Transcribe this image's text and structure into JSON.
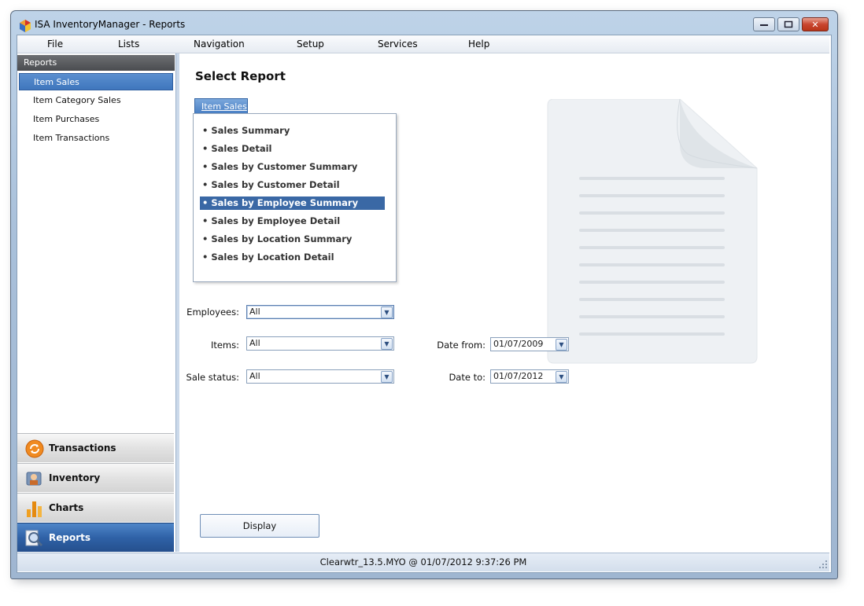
{
  "window": {
    "title": "ISA InventoryManager - Reports",
    "controls": {
      "minimize": "▭",
      "maximize": "□",
      "close": "✕"
    }
  },
  "menu": [
    "File",
    "Lists",
    "Navigation",
    "Setup",
    "Services",
    "Help"
  ],
  "sidebar": {
    "header": "Reports",
    "items": [
      {
        "label": "Item Sales",
        "selected": true
      },
      {
        "label": "Item Category Sales",
        "selected": false
      },
      {
        "label": "Item Purchases",
        "selected": false
      },
      {
        "label": "Item Transactions",
        "selected": false
      }
    ],
    "sections": [
      {
        "label": "Transactions",
        "icon": "refresh-icon"
      },
      {
        "label": "Inventory",
        "icon": "inventory-icon"
      },
      {
        "label": "Charts",
        "icon": "bar-chart-icon"
      },
      {
        "label": "Reports",
        "icon": "magnifier-icon",
        "active": true
      }
    ]
  },
  "main": {
    "title": "Select Report",
    "tab": "Item Sales",
    "reports": [
      "• Sales Summary",
      "• Sales Detail",
      "• Sales by Customer Summary",
      "• Sales by Customer Detail",
      "• Sales by Employee Summary",
      "• Sales by Employee Detail",
      "• Sales by Location Summary",
      "• Sales by Location Detail"
    ],
    "selected_report_index": 4,
    "filters": {
      "employees": {
        "label": "Employees:",
        "value": "All"
      },
      "items": {
        "label": "Items:",
        "value": "All"
      },
      "sale_status": {
        "label": "Sale status:",
        "value": "All"
      },
      "date_from": {
        "label": "Date from:",
        "value": "01/07/2009"
      },
      "date_to": {
        "label": "Date to:",
        "value": "01/07/2012"
      }
    },
    "display_button": "Display",
    "placeholder_icon": "document-icon"
  },
  "status": {
    "text": "Clearwtr_13.5.MYO  @  01/07/2012 9:37:26 PM"
  },
  "colors": {
    "accent": "#3f76bd",
    "selection": "#3a68a5",
    "nav_header": "#5c5e62"
  }
}
